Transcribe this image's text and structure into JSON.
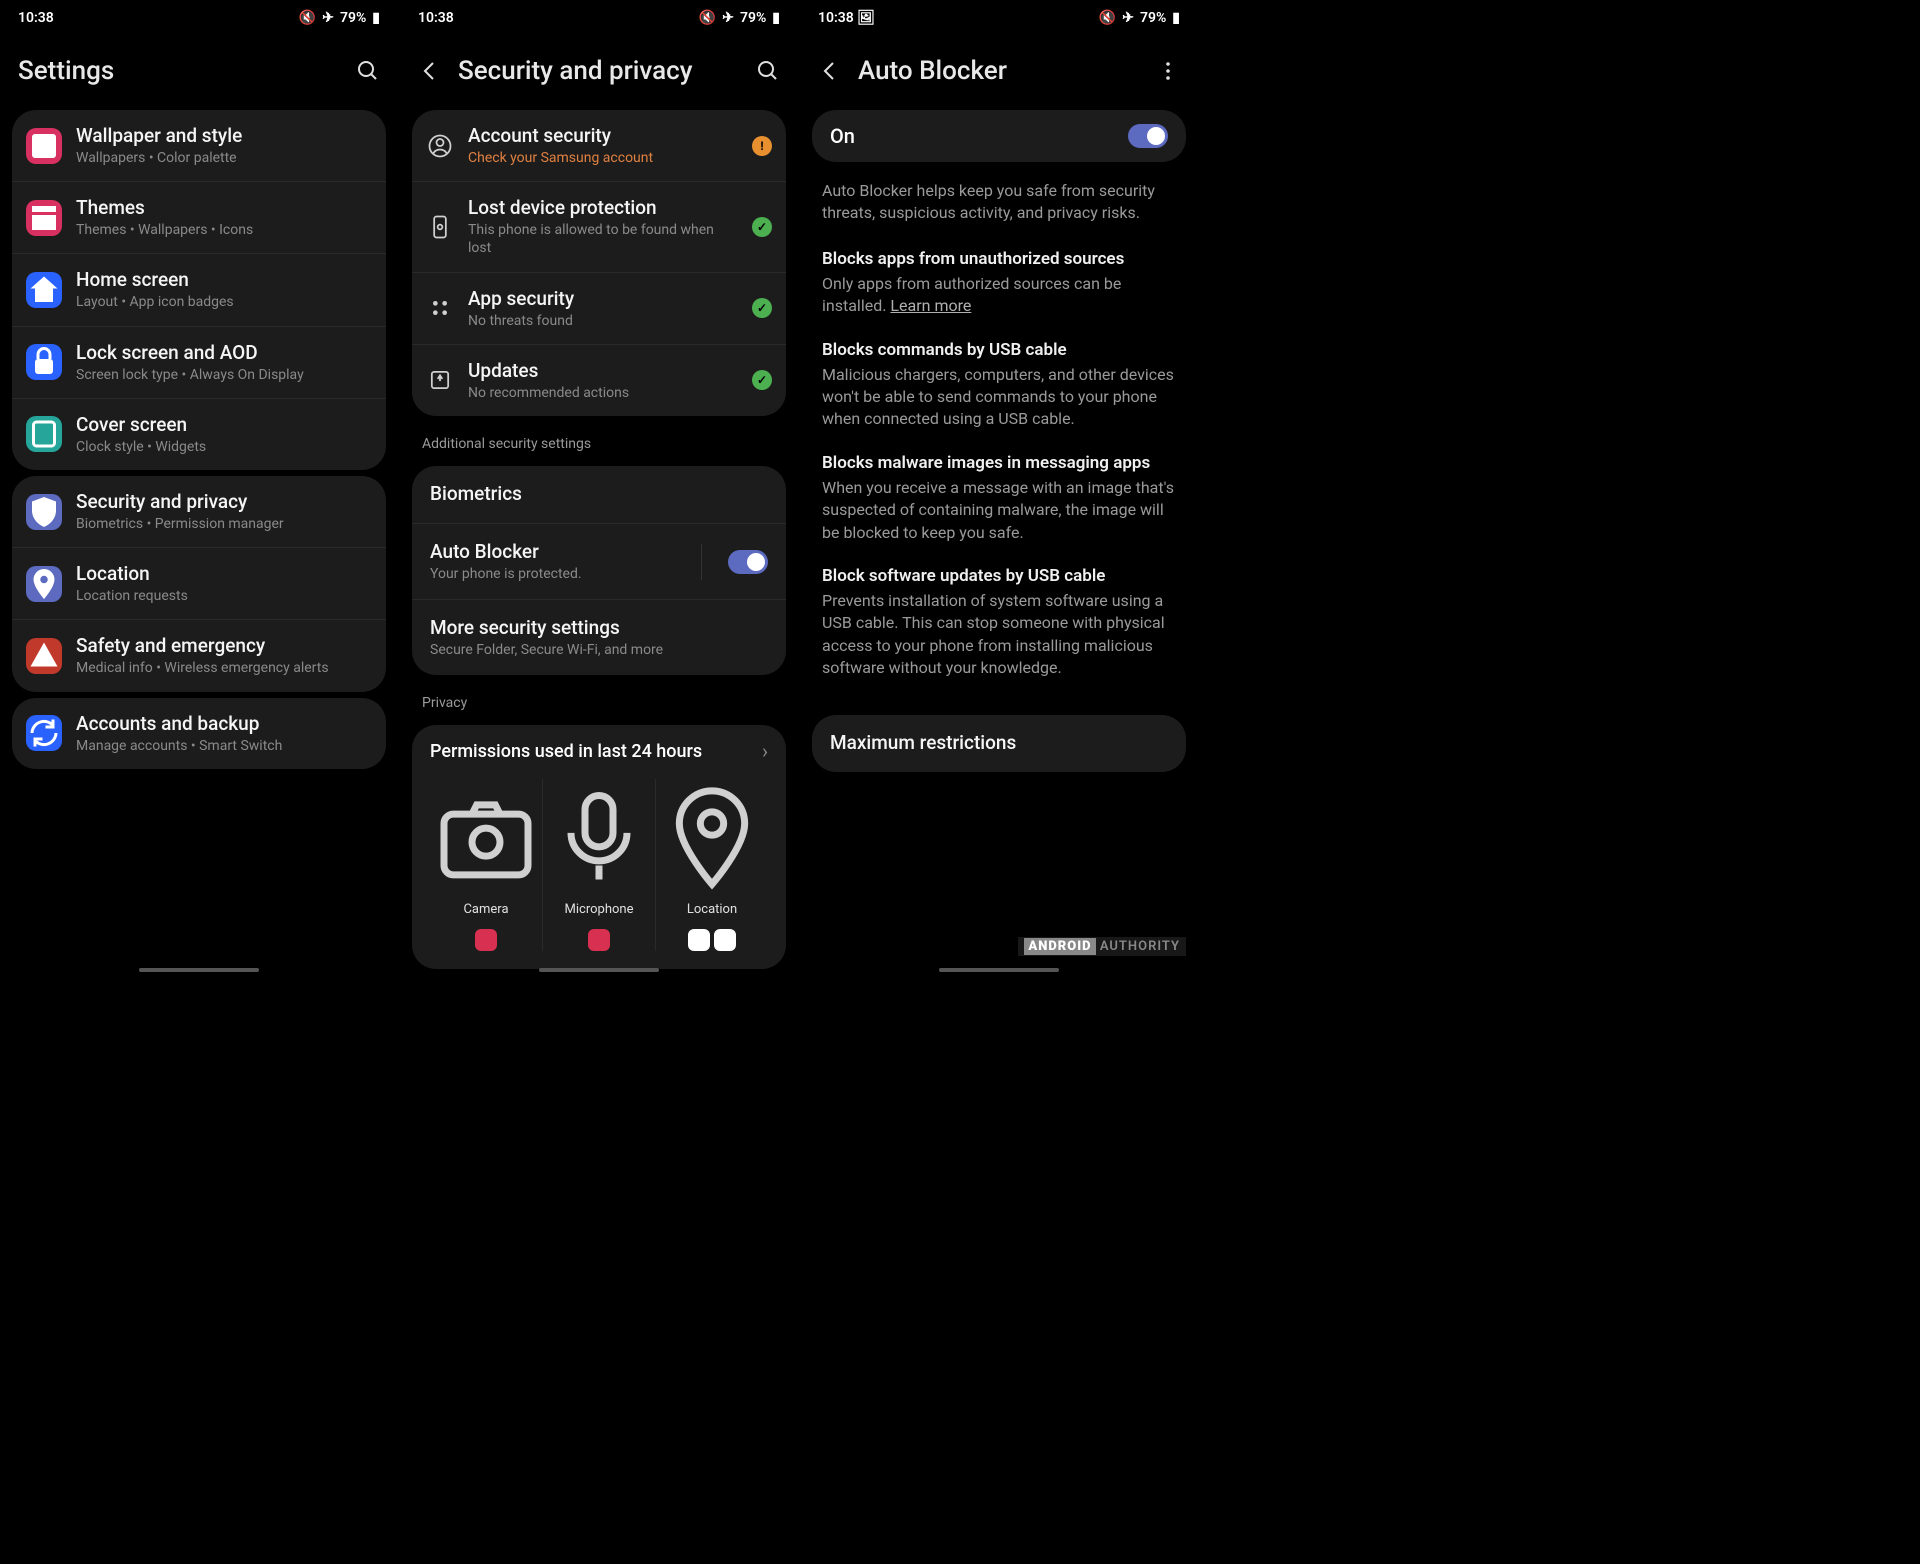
{
  "status": {
    "time": "10:38",
    "battery": "79%",
    "mute_icon": "mute",
    "airplane_icon": "airplane",
    "image_icon_p3": "image"
  },
  "p1": {
    "title": "Settings",
    "groups": [
      [
        {
          "icon": "wallpaper",
          "color": "#d83060",
          "title": "Wallpaper and style",
          "sub": "Wallpapers  •  Color palette"
        },
        {
          "icon": "themes",
          "color": "#d83060",
          "title": "Themes",
          "sub": "Themes  •  Wallpapers  •  Icons"
        },
        {
          "icon": "home",
          "color": "#2962ff",
          "title": "Home screen",
          "sub": "Layout  •  App icon badges"
        },
        {
          "icon": "lock",
          "color": "#2962ff",
          "title": "Lock screen and AOD",
          "sub": "Screen lock type  •  Always On Display"
        },
        {
          "icon": "cover",
          "color": "#26a69a",
          "title": "Cover screen",
          "sub": "Clock style  •  Widgets"
        }
      ],
      [
        {
          "icon": "shield",
          "color": "#5c6bc0",
          "title": "Security and privacy",
          "sub": "Biometrics  •  Permission manager"
        },
        {
          "icon": "location",
          "color": "#5c6bc0",
          "title": "Location",
          "sub": "Location requests"
        },
        {
          "icon": "emergency",
          "color": "#c0392b",
          "title": "Safety and emergency",
          "sub": "Medical info  •  Wireless emergency alerts"
        }
      ],
      [
        {
          "icon": "sync",
          "color": "#2962ff",
          "title": "Accounts and backup",
          "sub": "Manage accounts  •  Smart Switch"
        }
      ]
    ]
  },
  "p2": {
    "title": "Security and privacy",
    "main": [
      {
        "icon": "account",
        "title": "Account security",
        "sub": "Check your Samsung account",
        "status": "warn"
      },
      {
        "icon": "lost",
        "title": "Lost device protection",
        "sub": "This phone is allowed to be found when lost",
        "status": "ok"
      },
      {
        "icon": "apps",
        "title": "App security",
        "sub": "No threats found",
        "status": "ok"
      },
      {
        "icon": "updates",
        "title": "Updates",
        "sub": "No recommended actions",
        "status": "ok"
      }
    ],
    "additional_label": "Additional security settings",
    "additional": [
      {
        "title": "Biometrics",
        "sub": ""
      },
      {
        "title": "Auto Blocker",
        "sub": "Your phone is protected.",
        "toggle": true
      },
      {
        "title": "More security settings",
        "sub": "Secure Folder, Secure Wi-Fi, and more"
      }
    ],
    "privacy_label": "Privacy",
    "perms": {
      "title": "Permissions used in last 24 hours",
      "items": [
        {
          "icon": "camera",
          "label": "Camera"
        },
        {
          "icon": "mic",
          "label": "Microphone"
        },
        {
          "icon": "pin",
          "label": "Location"
        }
      ]
    }
  },
  "p3": {
    "title": "Auto Blocker",
    "on": "On",
    "desc": "Auto Blocker helps keep you safe from security threats, suspicious activity, and privacy risks.",
    "sections": [
      {
        "h": "Blocks apps from unauthorized sources",
        "p": "Only apps from authorized sources can be installed. ",
        "learn": "Learn more"
      },
      {
        "h": "Blocks commands by USB cable",
        "p": "Malicious chargers, computers, and other devices won't be able to send commands to your phone when connected using a USB cable."
      },
      {
        "h": "Blocks malware images in messaging apps",
        "p": "When you receive a message with an image that's suspected of containing malware, the image will be blocked to keep you safe."
      },
      {
        "h": "Block software updates by USB cable",
        "p": "Prevents installation of system software using a USB cable. This can stop someone with physical access to your phone from installing malicious software without your knowledge."
      }
    ],
    "max_restrictions": "Maximum restrictions"
  },
  "watermark": "ANDROID AUTHORITY"
}
